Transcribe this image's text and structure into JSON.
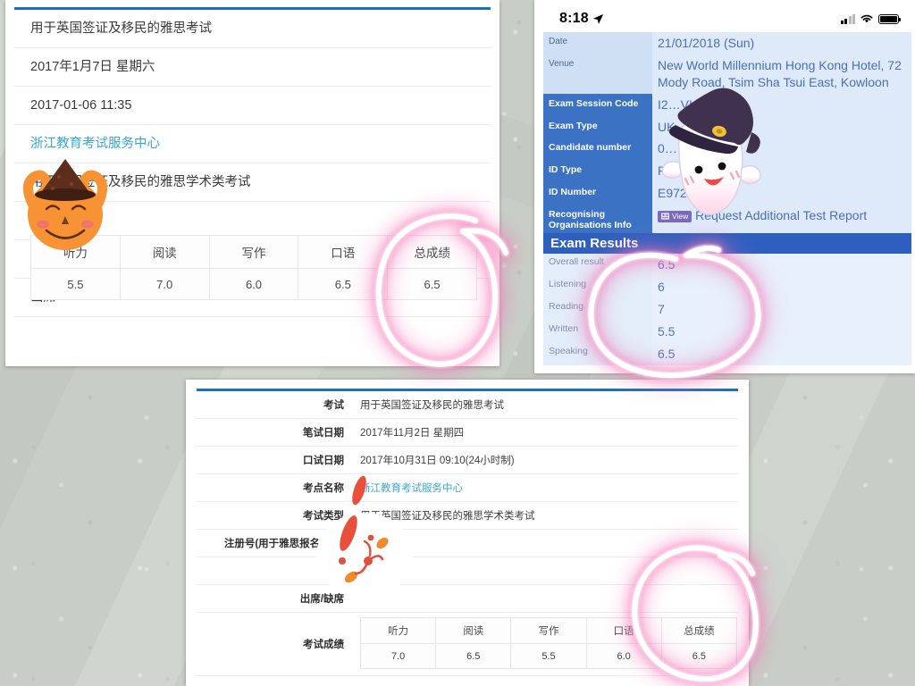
{
  "meta": {
    "background_color": "#c8cec7",
    "accent_blue": "#1d6dc4",
    "annotation_pink": "#f06ab0"
  },
  "panel_a": {
    "name": "zhejiang-ielts-result-cn",
    "rows": [
      "用于英国签证及移民的雅思考试",
      "2017年1月7日 星期六",
      "2017-01-06 11:35",
      "浙江教育考试服务中心",
      "用于英国签证及移民的雅思学术类考试",
      "",
      "",
      "出席"
    ],
    "link_row_index": 3,
    "score_table": {
      "headers": [
        "听力",
        "阅读",
        "写作",
        "口语",
        "总成绩"
      ],
      "values": [
        "5.5",
        "7.0",
        "6.0",
        "6.5",
        "6.5"
      ]
    }
  },
  "panel_b": {
    "name": "ielts-hongkong-result-en",
    "status_bar": {
      "time": "8:18",
      "location_icon": "location-arrow-icon",
      "signal_icon": "cellular-signal-icon",
      "wifi_icon": "wifi-icon",
      "battery_icon": "battery-full-icon"
    },
    "info_rows": [
      {
        "label": "Date",
        "value": "21/01/2018 (Sun)",
        "style": "light"
      },
      {
        "label": "Venue",
        "value": "New World Millennium Hong Kong Hotel, 72 Mody Road, Tsim Sha Tsui East, Kowloon",
        "style": "light"
      },
      {
        "label": "Exam Session Code",
        "value": "I2…VIAV2",
        "style": "dark"
      },
      {
        "label": "Exam Type",
        "value": "UK",
        "style": "dark"
      },
      {
        "label": "Candidate number",
        "value": "0…",
        "style": "dark"
      },
      {
        "label": "ID Type",
        "value": "Passport",
        "style": "dark"
      },
      {
        "label": "ID Number",
        "value": "E972…",
        "style": "dark"
      },
      {
        "label": "Recognising Organisations Info",
        "value": "Request Additional Test Report",
        "style": "dark",
        "badge": "View"
      }
    ],
    "results_header": "Exam Results",
    "results": [
      {
        "label": "Overall result",
        "value": "6.5"
      },
      {
        "label": "Listening",
        "value": "6"
      },
      {
        "label": "Reading",
        "value": "7"
      },
      {
        "label": "Written",
        "value": "5.5"
      },
      {
        "label": "Speaking",
        "value": "6.5"
      }
    ]
  },
  "panel_c": {
    "name": "ielts-result-detail-cn",
    "rows": [
      {
        "label": "考试",
        "value": "用于英国签证及移民的雅思考试",
        "link": false
      },
      {
        "label": "笔试日期",
        "value": "2017年11月2日 星期四",
        "link": false
      },
      {
        "label": "口试日期",
        "value": "2017年10月31日 09:10(24小时制)",
        "link": false
      },
      {
        "label": "考点名称",
        "value": "浙江教育考试服务中心",
        "link": true
      },
      {
        "label": "考试类型",
        "value": "用于英国签证及移民的雅思学术类考试",
        "link": false
      },
      {
        "label": "注册号(用于雅思报名流程)",
        "value": "",
        "link": false
      },
      {
        "label": "",
        "value": "",
        "link": false
      },
      {
        "label": "出席/缺席",
        "value": "",
        "link": false
      }
    ],
    "score_label": "考试成绩",
    "score_table": {
      "headers": [
        "听力",
        "阅读",
        "写作",
        "口语",
        "总成绩"
      ],
      "values": [
        "7.0",
        "6.5",
        "5.5",
        "6.0",
        "6.5"
      ]
    }
  },
  "stickers": [
    {
      "name": "pumpkin-witch-sticker",
      "description": "orange pumpkin face with brown witch hat"
    },
    {
      "name": "ghost-witch-sticker",
      "description": "white ghost with purple witch hat"
    },
    {
      "name": "white-blob-sticker",
      "description": "white blob with red and orange marks"
    }
  ],
  "annotations": [
    {
      "name": "circle-annotation-overall-a",
      "target": "panel_a total score"
    },
    {
      "name": "circle-annotation-results-b",
      "target": "panel_b exam results"
    },
    {
      "name": "circle-annotation-overall-c",
      "target": "panel_c total score"
    }
  ]
}
